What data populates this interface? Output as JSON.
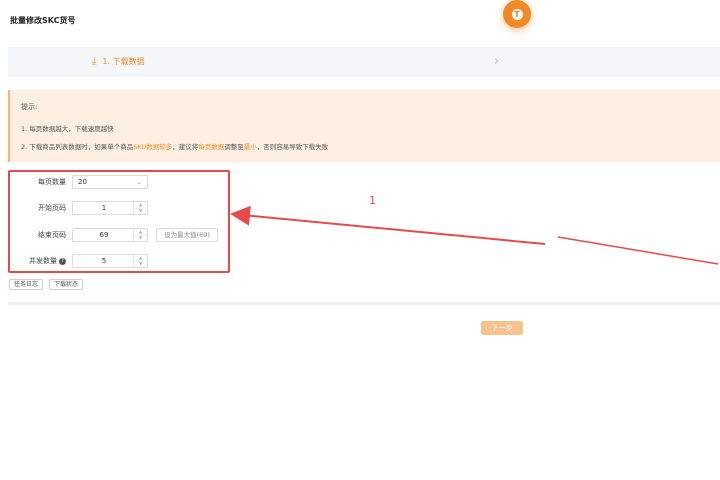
{
  "page": {
    "title": "批量修改SKC货号"
  },
  "fab": {
    "icon": "info-badge-icon",
    "color": "#f08a24"
  },
  "steps": [
    {
      "label": "1. 下载数据",
      "icon": "download-icon",
      "active": true
    }
  ],
  "notice": {
    "title": "提示:",
    "line1": "1. 每页数据越大，下载速度越快",
    "line2_parts": [
      "2. 下载商品列表数据时，如果单个商品",
      "SKU数据较多",
      "，建议将",
      "每页数据",
      "调整至",
      "最小",
      "，否则容易导致下载失败"
    ]
  },
  "form": {
    "page_size": {
      "label": "每页数量",
      "value": "20"
    },
    "start_page": {
      "label": "开始页码",
      "value": "1"
    },
    "end_page": {
      "label": "结束页码",
      "value": "69",
      "hint_button": "设为最大值(69)"
    },
    "concurrency": {
      "label": "并发数量",
      "value": "5",
      "help_icon": "question-circle-icon"
    }
  },
  "buttons": {
    "task_log": "任务日志",
    "download_status": "下载状态",
    "next": "下一步"
  },
  "annotation": {
    "number": "1",
    "color": "#e64a4a"
  },
  "colors": {
    "accent": "#f08a24",
    "notice_bg": "#fdf0e3",
    "annotation_red": "#e64a4a"
  }
}
